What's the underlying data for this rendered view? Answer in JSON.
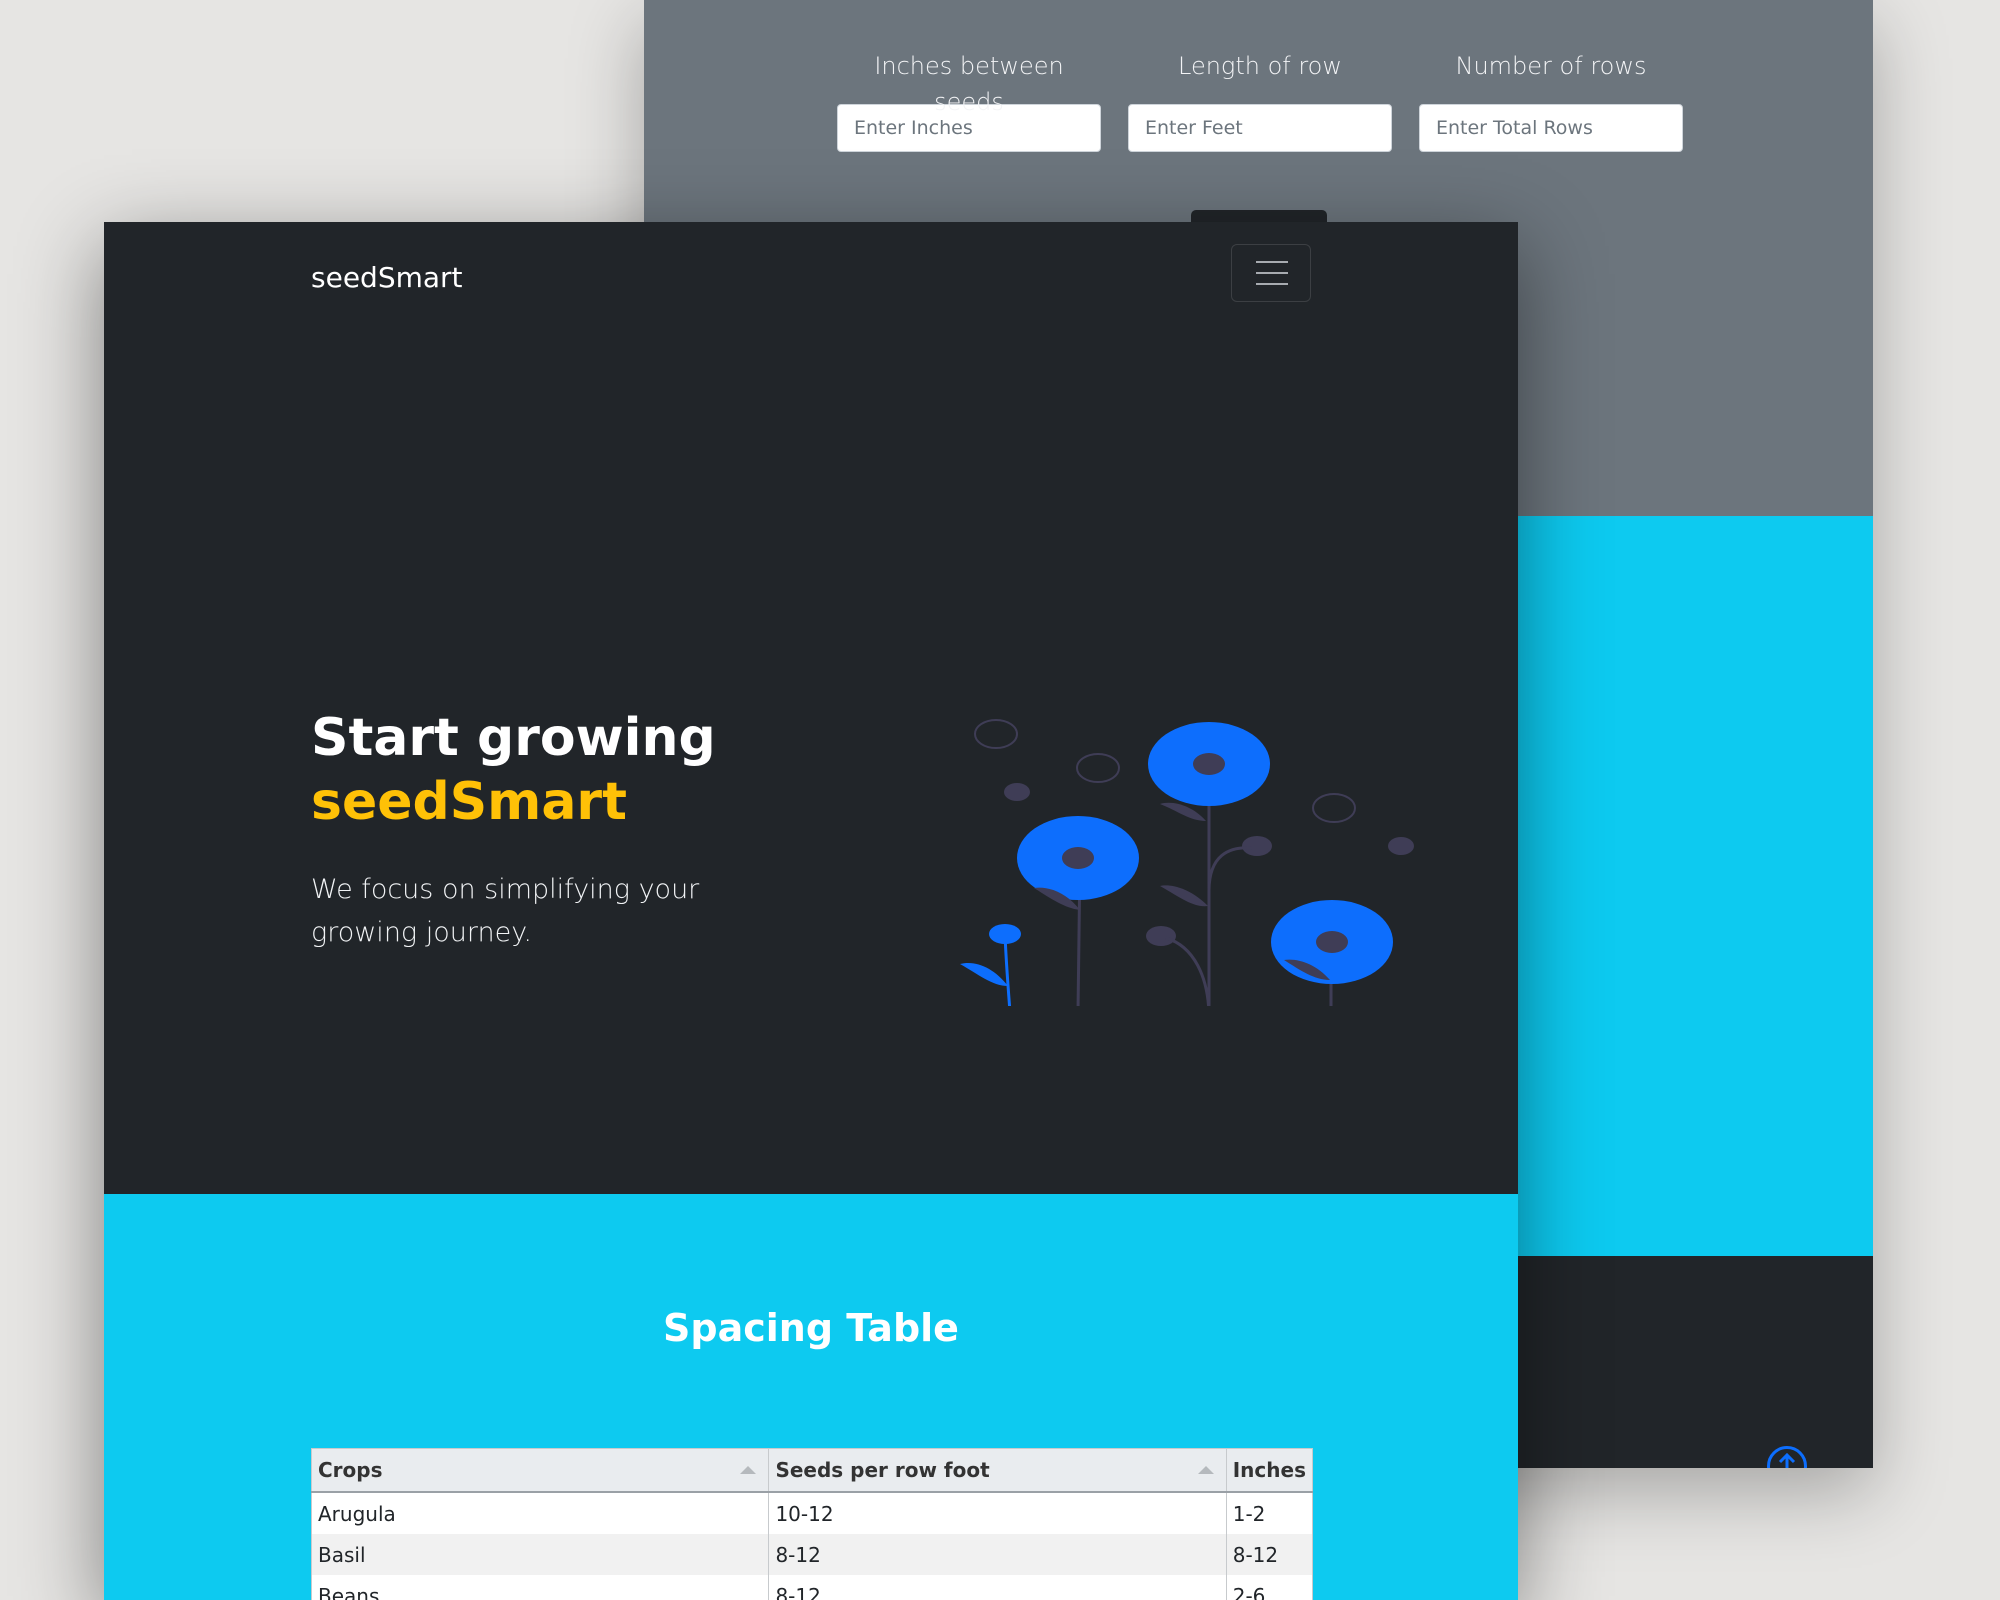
{
  "back_page": {
    "fields": [
      {
        "label": "Inches between seeds",
        "placeholder": "Enter Inches"
      },
      {
        "label": "Length of row",
        "placeholder": "Enter Feet"
      },
      {
        "label": "Number of rows",
        "placeholder": "Enter Total Rows"
      }
    ]
  },
  "navbar": {
    "brand": "seedSmart"
  },
  "hero": {
    "title_line1": "Start growing",
    "title_line2": "seedSmart",
    "lead": "We focus on simplifying your growing journey."
  },
  "spacing_section": {
    "title": "Spacing Table",
    "columns": [
      "Crops",
      "Seeds per row foot",
      "Inches"
    ],
    "rows": [
      [
        "Arugula",
        "10-12",
        "1-2"
      ],
      [
        "Basil",
        "8-12",
        "8-12"
      ],
      [
        "Beans",
        "8-12",
        "2-6"
      ]
    ]
  },
  "colors": {
    "dark": "#212529",
    "gray": "#6c757d",
    "cyan": "#0dcaf0",
    "accent_yellow": "#ffc107",
    "flower_blue": "#0d6efd"
  }
}
